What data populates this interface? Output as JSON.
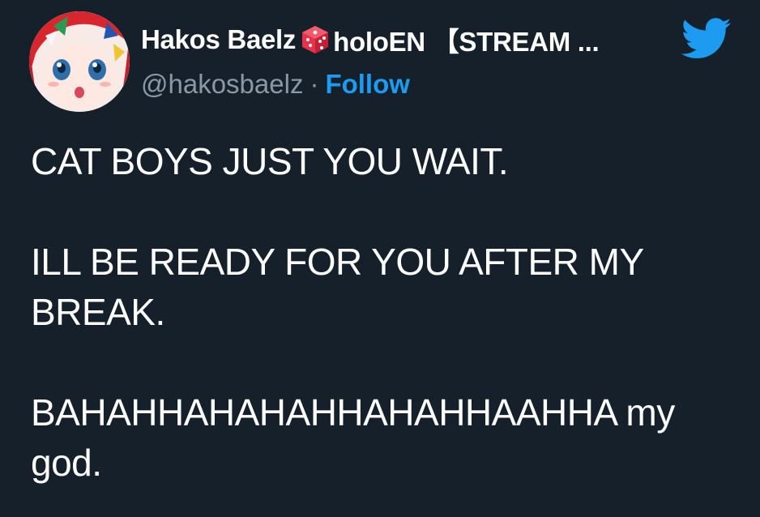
{
  "author": {
    "display_name": "Hakos Baelz",
    "display_name_suffix": "holoEN 【STREAM ...",
    "handle": "@hakosbaelz",
    "separator": "·",
    "follow_label": "Follow"
  },
  "icons": {
    "badge": "dice-icon",
    "brand": "twitter-bird-icon",
    "avatar": "anime-character-avatar"
  },
  "tweet": {
    "lines": [
      "CAT BOYS JUST YOU WAIT.",
      "ILL BE READY FOR YOU AFTER MY BREAK.",
      "BAHAHHAHAHAHHAHAHHAAHHA my god."
    ]
  },
  "colors": {
    "background": "#15202b",
    "text": "#ffffff",
    "muted": "#8b98a5",
    "accent": "#1d9bf0",
    "dice": "#e8324a"
  }
}
